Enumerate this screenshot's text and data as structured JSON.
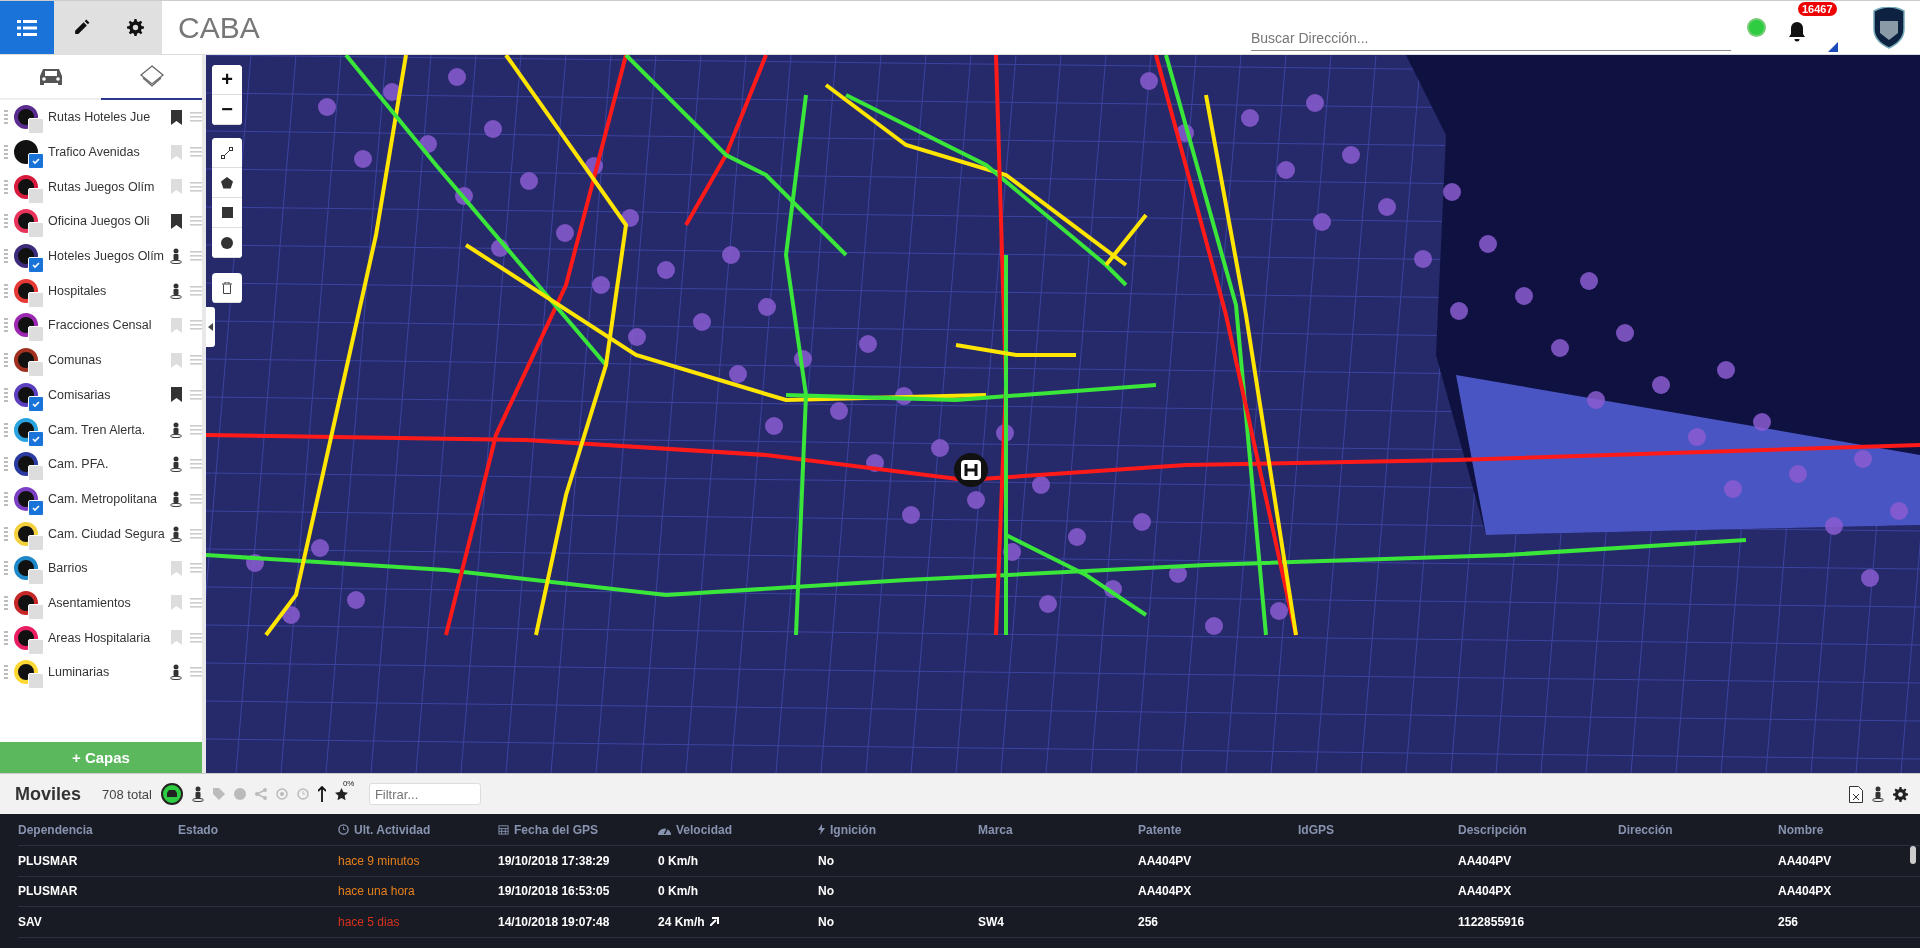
{
  "topbar": {
    "title": "CABA",
    "buttons": [
      {
        "kind": "list",
        "selected": true
      },
      {
        "kind": "pencil",
        "selected": false
      },
      {
        "kind": "gear",
        "selected": false
      }
    ],
    "search": {
      "placeholder": "Buscar Dirección..."
    },
    "connection_on": true,
    "notifications": "16467"
  },
  "sidebar": {
    "tabs": [
      {
        "kind": "car",
        "selected": false
      },
      {
        "kind": "layers",
        "selected": true
      }
    ],
    "layers": [
      {
        "label": "Rutas Hoteles Jue",
        "checked": false,
        "color": "#5b2c8f",
        "kind": "bookmark",
        "marker_on": true
      },
      {
        "label": "Trafico Avenidas",
        "checked": true,
        "color": "#111111",
        "kind": "bookmark",
        "marker_on": false
      },
      {
        "label": "Rutas Juegos Olím",
        "checked": false,
        "color": "#d81b3c",
        "kind": "bookmark",
        "marker_on": false
      },
      {
        "label": "Oficina Juegos Oli",
        "checked": false,
        "color": "#e8335a",
        "kind": "bookmark",
        "marker_on": true
      },
      {
        "label": "Hoteles Juegos Olím",
        "checked": true,
        "color": "#3d2a7a",
        "kind": "pin",
        "marker_on": true
      },
      {
        "label": "Hospitales",
        "checked": false,
        "color": "#e53935",
        "kind": "pin",
        "marker_on": true
      },
      {
        "label": "Fracciones Censal",
        "checked": false,
        "color": "#9c27b0",
        "kind": "bookmark",
        "marker_on": false
      },
      {
        "label": "Comunas",
        "checked": false,
        "color": "#a0301f",
        "kind": "bookmark",
        "marker_on": false
      },
      {
        "label": "Comisarias",
        "checked": true,
        "color": "#5c3fbf",
        "kind": "bookmark",
        "marker_on": true
      },
      {
        "label": "Cam. Tren Alerta.",
        "checked": true,
        "color": "#29a3e0",
        "kind": "pin",
        "marker_on": true
      },
      {
        "label": "Cam. PFA.",
        "checked": false,
        "color": "#2a3a9f",
        "kind": "pin",
        "marker_on": true
      },
      {
        "label": "Cam. Metropolitana",
        "checked": true,
        "color": "#7b3fc4",
        "kind": "pin",
        "marker_on": true
      },
      {
        "label": "Cam. Ciudad Segura",
        "checked": false,
        "color": "#f4d03f",
        "kind": "pin",
        "marker_on": true
      },
      {
        "label": "Barrios",
        "checked": false,
        "color": "#1e88c8",
        "kind": "bookmark",
        "marker_on": false
      },
      {
        "label": "Asentamientos",
        "checked": false,
        "color": "#c62828",
        "kind": "bookmark",
        "marker_on": false
      },
      {
        "label": "Areas Hospitalaria",
        "checked": false,
        "color": "#e91e63",
        "kind": "bookmark",
        "marker_on": false
      },
      {
        "label": "Luminarias",
        "checked": false,
        "color": "#fdd835",
        "kind": "pin",
        "marker_on": true
      }
    ],
    "add_button": "+ Capas"
  },
  "map": {
    "zoom_in": "+",
    "zoom_out": "−"
  },
  "vehicles": {
    "title": "Moviles",
    "total": "708 total",
    "percent": "0%",
    "filter": {
      "placeholder": "Filtrar..."
    },
    "columns": [
      "Dependencia",
      "Estado",
      "Ult. Actividad",
      "Fecha del GPS",
      "Velocidad",
      "Ignición",
      "Marca",
      "Patente",
      "IdGPS",
      "Descripción",
      "Dirección",
      "Nombre"
    ],
    "rows": [
      {
        "dependencia": "PLUSMAR",
        "ult_actividad": "hace 9 minutos",
        "fecha_gps": "19/10/2018 17:38:29",
        "velocidad": "0 Km/h",
        "ignicion": "No",
        "patente": "AA404PV",
        "descripcion": "AA404PV",
        "nombre": "AA404PV",
        "color": "#e8801a",
        "speed_arrow": false
      },
      {
        "dependencia": "PLUSMAR",
        "ult_actividad": "hace una hora",
        "fecha_gps": "19/10/2018 16:53:05",
        "velocidad": "0 Km/h",
        "ignicion": "No",
        "patente": "AA404PX",
        "descripcion": "AA404PX",
        "nombre": "AA404PX",
        "color": "#e8801a",
        "speed_arrow": false
      },
      {
        "dependencia": "SAV",
        "ult_actividad": "hace 5 dias",
        "fecha_gps": "14/10/2018 19:07:48",
        "velocidad": "24 Km/h",
        "ignicion": "No",
        "marca": "SW4",
        "patente": "256",
        "descripcion": "1122855916",
        "nombre": "256",
        "color": "#d8321e",
        "speed_arrow": true
      }
    ]
  }
}
